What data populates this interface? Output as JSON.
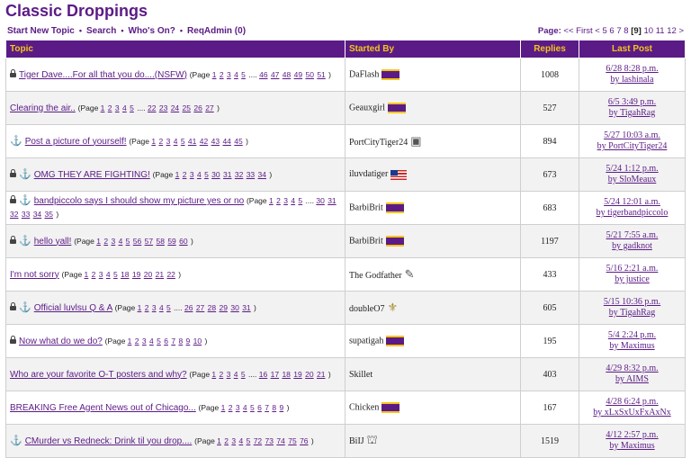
{
  "page_title": "Classic Droppings",
  "nav": {
    "new_topic": "Start New Topic",
    "search": "Search",
    "whos_on": "Who's On?",
    "reqadmin": "ReqAdmin (0)",
    "sep": "•"
  },
  "pager": {
    "label": "Page:",
    "first": "<< First",
    "prev": "<",
    "pages_before": [
      "5",
      "6",
      "7",
      "8"
    ],
    "current": "[9]",
    "pages_after": [
      "10",
      "11",
      "12"
    ],
    "next": ">"
  },
  "columns": {
    "topic": "Topic",
    "started_by": "Started By",
    "replies": "Replies",
    "last_post": "Last Post"
  },
  "colors": {
    "accent": "#5b1b86",
    "header_text": "#f5c518"
  },
  "ellipsis": "....",
  "page_prefix": "(Page",
  "page_suffix": ")",
  "topics": [
    {
      "title": "Tiger Dave....For all that you do....(NSFW)",
      "icons": [
        "lock-icon"
      ],
      "pages": [
        "1",
        "2",
        "3",
        "4",
        "5",
        "46",
        "47",
        "48",
        "49",
        "50",
        "51"
      ],
      "author": "DaFlash",
      "author_icon": "lsu-badge-icon",
      "replies": "1008",
      "last_date": "6/28 8:28 p.m.",
      "last_by": "by lashinala"
    },
    {
      "title": "Clearing the air..",
      "icons": [],
      "pages": [
        "1",
        "2",
        "3",
        "4",
        "5",
        "22",
        "23",
        "24",
        "25",
        "26",
        "27"
      ],
      "author": "Geauxgirl",
      "author_icon": "lsu-badge-icon",
      "replies": "527",
      "last_date": "6/5 3:49 p.m.",
      "last_by": "by TigahRag"
    },
    {
      "title": "Post a picture of yourself!",
      "icons": [
        "anchor-icon"
      ],
      "pages": [
        "1",
        "2",
        "3",
        "4",
        "5",
        "41",
        "42",
        "43",
        "44",
        "45"
      ],
      "author": "PortCityTiger24",
      "author_icon": "cpu-icon",
      "replies": "894",
      "last_date": "5/27 10:03 a.m.",
      "last_by": "by PortCityTiger24"
    },
    {
      "title": "OMG THEY ARE FIGHTING!",
      "icons": [
        "lock-icon",
        "anchor-icon"
      ],
      "pages": [
        "1",
        "2",
        "3",
        "4",
        "5",
        "30",
        "31",
        "32",
        "33",
        "34"
      ],
      "author": "iluvdatiger",
      "author_icon": "us-flag-icon",
      "replies": "673",
      "last_date": "5/24 1:12 p.m.",
      "last_by": "by SloMeaux"
    },
    {
      "title": "bandpiccolo says I should show my picture yes or no",
      "icons": [
        "lock-icon",
        "anchor-icon"
      ],
      "pages": [
        "1",
        "2",
        "3",
        "4",
        "5",
        "30",
        "31",
        "32",
        "33",
        "34",
        "35"
      ],
      "author": "BarbiBrit",
      "author_icon": "lsu-badge-icon",
      "replies": "683",
      "last_date": "5/24 12:01 a.m.",
      "last_by": "by tigerbandpiccolo"
    },
    {
      "title": "hello yall!",
      "icons": [
        "lock-icon",
        "anchor-icon"
      ],
      "pages": [
        "1",
        "2",
        "3",
        "4",
        "5",
        "56",
        "57",
        "58",
        "59",
        "60"
      ],
      "author": "BarbiBrit",
      "author_icon": "lsu-badge-icon",
      "replies": "1197",
      "last_date": "5/21 7:55 a.m.",
      "last_by": "by gadknot"
    },
    {
      "title": "I'm not sorry",
      "icons": [],
      "pages": [
        "1",
        "2",
        "3",
        "4",
        "5",
        "18",
        "19",
        "20",
        "21",
        "22"
      ],
      "author": "The Godfather",
      "author_icon": "tie-icon",
      "replies": "433",
      "last_date": "5/16 2:21 a.m.",
      "last_by": "by justice"
    },
    {
      "title": "Official luvlsu Q & A",
      "icons": [
        "lock-icon",
        "anchor-icon"
      ],
      "pages": [
        "1",
        "2",
        "3",
        "4",
        "5",
        "26",
        "27",
        "28",
        "29",
        "30",
        "31"
      ],
      "author": "doubleO7",
      "author_icon": "fleur-de-lis-icon",
      "replies": "605",
      "last_date": "5/15 10:36 p.m.",
      "last_by": "by TigahRag"
    },
    {
      "title": "Now what do we do?",
      "icons": [
        "lock-icon"
      ],
      "pages": [
        "1",
        "2",
        "3",
        "4",
        "5",
        "6",
        "7",
        "8",
        "9",
        "10"
      ],
      "author": "supatigah",
      "author_icon": "lsu-badge-icon",
      "replies": "195",
      "last_date": "5/4 2:24 p.m.",
      "last_by": "by Maximus"
    },
    {
      "title": "Who are your favorite O-T posters and why?",
      "icons": [],
      "pages": [
        "1",
        "2",
        "3",
        "4",
        "5",
        "16",
        "17",
        "18",
        "19",
        "20",
        "21"
      ],
      "author": "Skillet",
      "author_icon": "",
      "replies": "403",
      "last_date": "4/29 8:32 p.m.",
      "last_by": "by AIMS"
    },
    {
      "title": "BREAKING Free Agent News out of Chicago...",
      "icons": [],
      "pages": [
        "1",
        "2",
        "3",
        "4",
        "5",
        "6",
        "7",
        "8",
        "9"
      ],
      "author": "Chicken",
      "author_icon": "lsu-badge-icon",
      "replies": "167",
      "last_date": "4/28 6:24 p.m.",
      "last_by": "by xLxSxUxFxAxNx"
    },
    {
      "title": "CMurder vs Redneck: Drink til you drop....",
      "icons": [
        "anchor-icon"
      ],
      "pages": [
        "1",
        "2",
        "3",
        "4",
        "5",
        "72",
        "73",
        "74",
        "75",
        "76"
      ],
      "author": "BiIJ",
      "author_icon": "hat-icon",
      "replies": "1519",
      "last_date": "4/12 2:57 p.m.",
      "last_by": "by Maximus"
    }
  ]
}
